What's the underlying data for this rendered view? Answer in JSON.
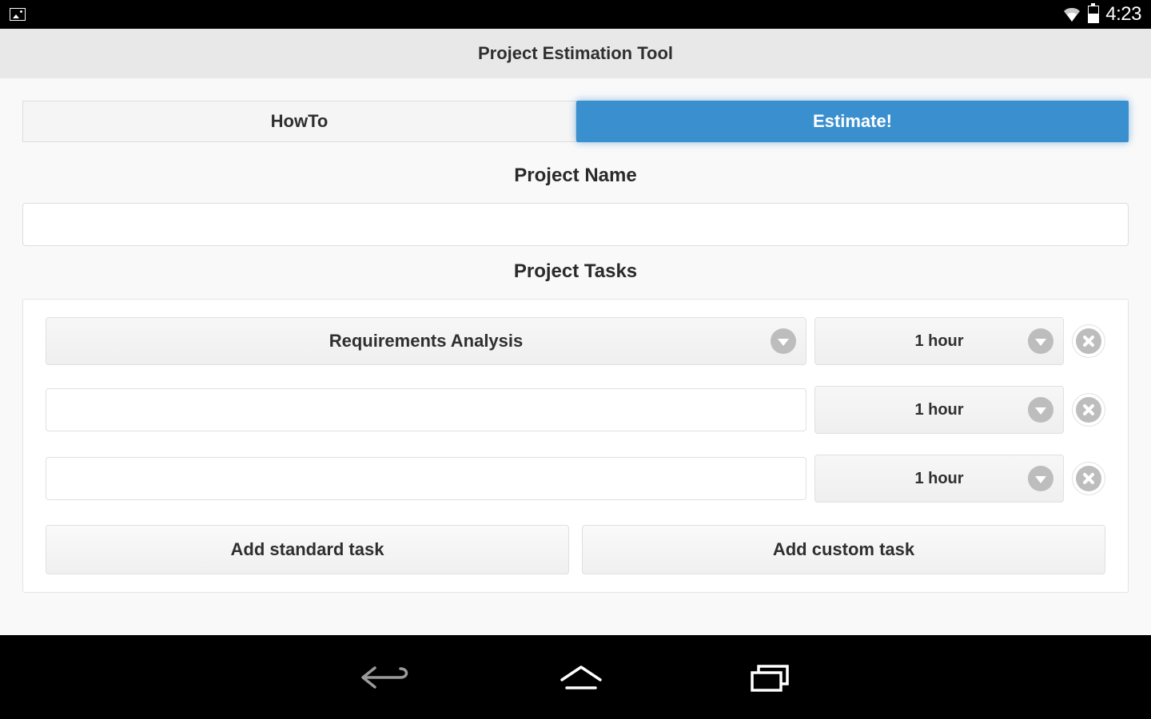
{
  "status_bar": {
    "time": "4:23"
  },
  "app": {
    "title": "Project Estimation Tool"
  },
  "tabs": {
    "howto": "HowTo",
    "estimate": "Estimate!"
  },
  "sections": {
    "project_name": "Project Name",
    "project_tasks": "Project Tasks"
  },
  "project_name_value": "",
  "tasks": [
    {
      "name": "Requirements Analysis",
      "duration": "1 hour",
      "is_dropdown": true
    },
    {
      "name": "",
      "duration": "1 hour",
      "is_dropdown": false
    },
    {
      "name": "",
      "duration": "1 hour",
      "is_dropdown": false
    }
  ],
  "buttons": {
    "add_standard": "Add standard task",
    "add_custom": "Add custom task"
  }
}
